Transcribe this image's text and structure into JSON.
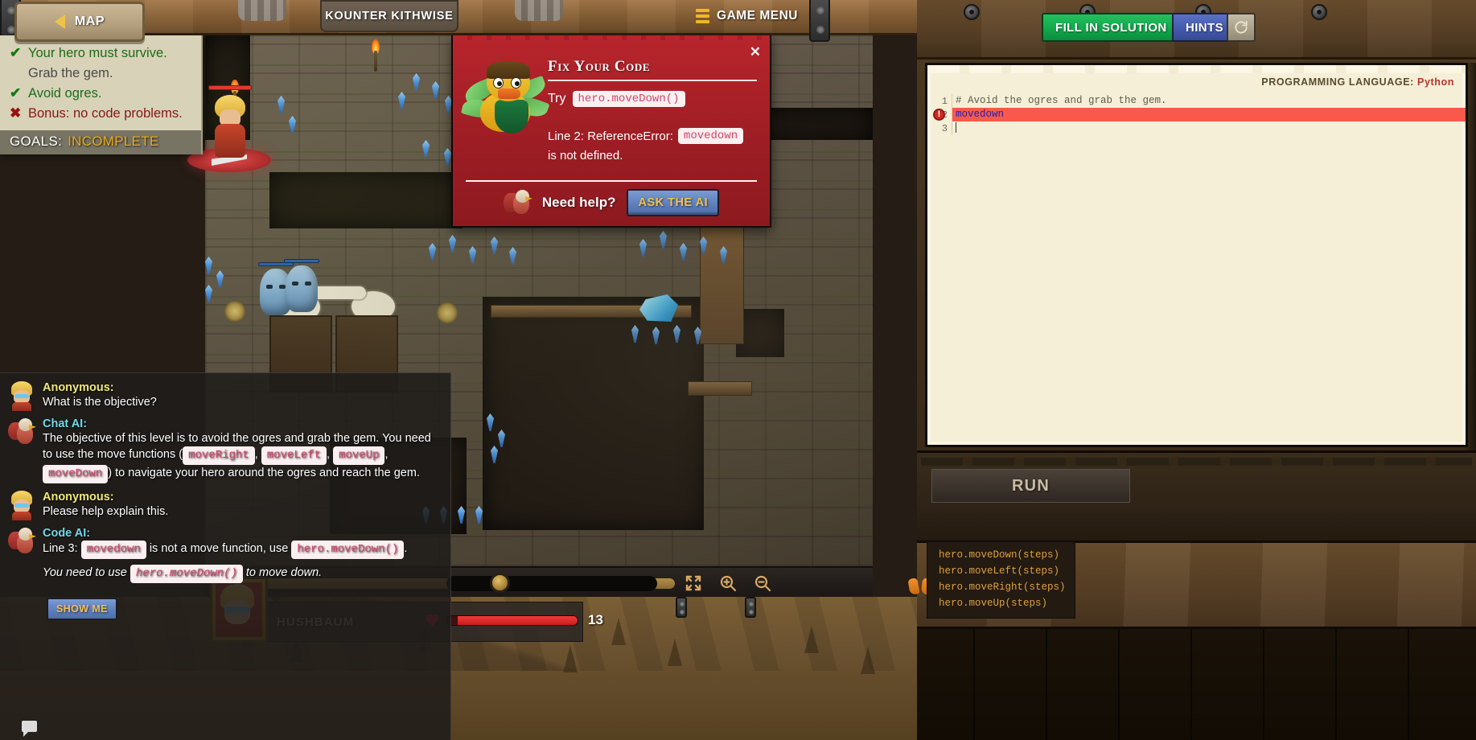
{
  "topbar": {
    "map_label": "MAP",
    "level_title": "KOUNTER KITHWISE",
    "game_menu_label": "GAME MENU"
  },
  "goals": {
    "items": [
      {
        "mark": "check",
        "text": "Your hero must survive.",
        "state": "ok"
      },
      {
        "mark": "none",
        "text": "Grab the gem.",
        "state": "pending"
      },
      {
        "mark": "check",
        "text": "Avoid ogres.",
        "state": "ok"
      },
      {
        "mark": "cross",
        "text": "Bonus: no code problems.",
        "state": "bad"
      }
    ],
    "status_label": "GOALS:",
    "status_value": "INCOMPLETE"
  },
  "error_alert": {
    "title": "Fix Your Code",
    "close_label": "✕",
    "try_label": "Try",
    "try_code": "hero.moveDown()",
    "error_prefix": "Line 2: ReferenceError:",
    "error_code": "movedown",
    "error_suffix": "is not defined.",
    "need_help_label": "Need help?",
    "ask_ai_label": "ASK THE AI"
  },
  "chat": {
    "messages": [
      {
        "speaker": "Anonymous:",
        "role": "user",
        "parts": [
          {
            "t": "text",
            "v": "What is the objective?"
          }
        ]
      },
      {
        "speaker": "Chat AI:",
        "role": "ai",
        "parts": [
          {
            "t": "text",
            "v": "The objective of this level is to avoid the ogres and grab the gem. You need to use the move functions ("
          },
          {
            "t": "code",
            "v": "moveRight"
          },
          {
            "t": "text",
            "v": ", "
          },
          {
            "t": "code",
            "v": "moveLeft"
          },
          {
            "t": "text",
            "v": ", "
          },
          {
            "t": "code",
            "v": "moveUp"
          },
          {
            "t": "text",
            "v": ", "
          },
          {
            "t": "code",
            "v": "moveDown"
          },
          {
            "t": "text",
            "v": ") to navigate your hero around the ogres and reach the gem."
          }
        ]
      },
      {
        "speaker": "Anonymous:",
        "role": "user",
        "parts": [
          {
            "t": "text",
            "v": "Please help explain this."
          }
        ]
      },
      {
        "speaker": "Code AI:",
        "role": "ai",
        "parts": [
          {
            "t": "text",
            "v": "Line 3: "
          },
          {
            "t": "code",
            "v": "movedown"
          },
          {
            "t": "text",
            "v": " is not a move function, use "
          },
          {
            "t": "code",
            "v": "hero.moveDown()"
          },
          {
            "t": "text",
            "v": "."
          }
        ],
        "italic_parts": [
          {
            "t": "text",
            "v": "You need to use "
          },
          {
            "t": "code",
            "v": "hero.moveDown()"
          },
          {
            "t": "text",
            "v": " to move down."
          }
        ]
      }
    ],
    "show_me_label": "SHOW ME"
  },
  "hud": {
    "hero_name": "HUSHBAUM",
    "hp_value": "13",
    "hp_percent": 92,
    "playback_percent": 43,
    "controls": [
      {
        "name": "fullscreen-icon"
      },
      {
        "name": "zoom-in-icon"
      },
      {
        "name": "zoom-out-icon"
      }
    ]
  },
  "code_panel": {
    "fill_in_solution_label": "FILL IN SOLUTION",
    "hints_label": "HINTS",
    "reload_label": "⟳",
    "language_label": "PROGRAMMING LANGUAGE:",
    "language_value": "Python",
    "lines": [
      {
        "n": "1",
        "text": "# Avoid the ogres and grab the gem.",
        "error": false
      },
      {
        "n": "2",
        "text": "movedown",
        "error": true
      },
      {
        "n": "3",
        "text": "",
        "error": false
      }
    ],
    "run_label": "RUN",
    "autocomplete": [
      "hero.moveDown(steps)",
      "hero.moveLeft(steps)",
      "hero.moveRight(steps)",
      "hero.moveUp(steps)"
    ]
  },
  "colors": {
    "accent_green": "#13a84c",
    "accent_blue": "#4459ad",
    "error_red": "#9e1d24",
    "goal_ok": "#1b6d1a",
    "goal_bad": "#8a1616",
    "goal_status": "#e8a91c",
    "code_chip": "#d1456c"
  }
}
